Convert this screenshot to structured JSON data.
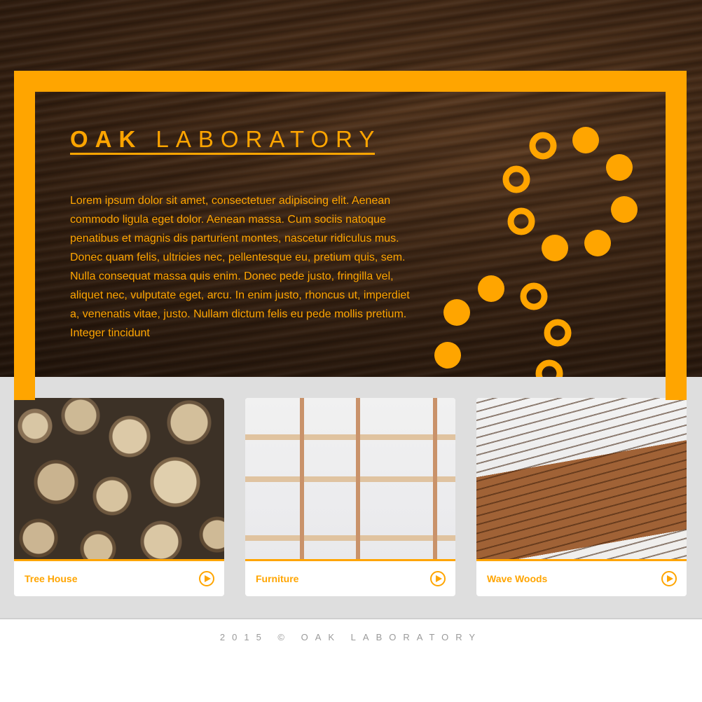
{
  "hero": {
    "title_bold": "OAK",
    "title_rest": "LABORATORY",
    "body": "Lorem ipsum dolor sit amet, consectetuer adipiscing elit. Aenean commodo ligula eget dolor. Aenean massa. Cum sociis natoque penatibus et magnis dis parturient montes, nascetur ridiculus mus. Donec quam felis, ultricies nec, pellentesque eu, pretium quis, sem. Nulla consequat massa quis enim. Donec pede justo, fringilla vel, aliquet nec, vulputate eget, arcu. In enim justo, rhoncus ut, imperdiet a, venenatis vitae, justo. Nullam dictum felis eu pede mollis pretium. Integer tincidunt"
  },
  "cards": [
    {
      "label": "Tree House",
      "icon": "play-icon"
    },
    {
      "label": "Furniture",
      "icon": "play-icon"
    },
    {
      "label": "Wave Woods",
      "icon": "play-icon"
    }
  ],
  "footer": {
    "text": "2015 © OAK LABORATORY"
  },
  "colors": {
    "accent": "#ffa500",
    "gallery_bg": "#dedede",
    "footer_text": "#9a9a9a"
  }
}
